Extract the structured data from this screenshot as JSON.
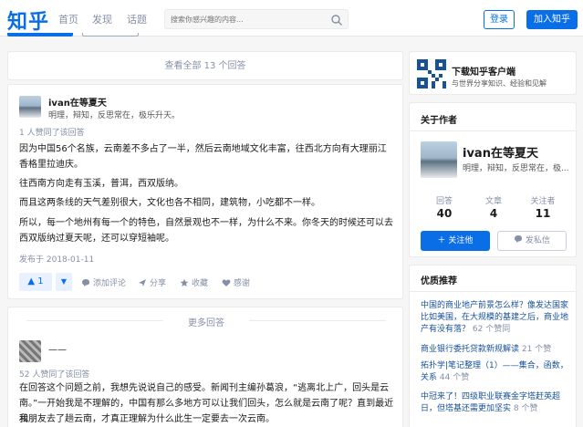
{
  "header": {
    "logo": "知乎",
    "nav": [
      "首页",
      "发现",
      "话题"
    ],
    "search_placeholder": "搜索你感兴趣的内容...",
    "login": "登录",
    "join": "加入知乎"
  },
  "view_all": "查看全部 13 个回答",
  "answer": {
    "author": "ivan在等夏天",
    "bio": "明理，辩知，反思常在，极乐升天。",
    "votes_note": "1 人赞同了该回答",
    "paragraphs": [
      "因为中国56个名族，云南差不多占了一半，然后云南地域文化丰富，往西北方向有大理丽江香格里拉迪庆。",
      "往西南方向走有玉溪，普洱，西双版纳。",
      "而且这两条线的天气差别很大，文化也各不相同，建筑物，小吃都不一样。",
      "所以，每一个地州有每一个的特色，自然景观也不一样，为什么不来。你冬天的时候还可以去西双版纳过夏天呢，还可以穿短袖呢。"
    ],
    "date": "发布于 2018-01-11",
    "vote_count": "1",
    "actions": [
      "添加评论",
      "分享",
      "收藏",
      "感谢"
    ]
  },
  "more": {
    "title": "更多回答",
    "author": "——",
    "votes_note": "52 人赞同了该回答",
    "text_lines": [
      "在回答这个问题之前，我想先说说自己的感受。新闻刊主编孙葛浪，“逃离北上广，回头是云",
      "南。”一开始我是不理解的，中国有那么多地方可以让我们回头，怎么就是云南了呢？直到最近我",
      "和朋友去了趟云南，才真正理解为什么此生一定要去一次云南。"
    ]
  },
  "app": {
    "title": "下载知乎客户端",
    "subtitle": "与世界分享知识、经验和见解"
  },
  "about": {
    "title": "关于作者",
    "name": "ivan在等夏天",
    "bio": "明理，辩知，反思常在，极...",
    "stats": [
      {
        "label": "回答",
        "value": "40"
      },
      {
        "label": "文章",
        "value": "4"
      },
      {
        "label": "关注者",
        "value": "11"
      }
    ],
    "follow": "关注他",
    "message": "发私信"
  },
  "recommend": {
    "title": "优质推荐",
    "items": [
      {
        "lines": [
          "中国的商业地产前景怎么样？像发达国家",
          "比如美国，在大规模的基建之后，商业地",
          "产有没有落？"
        ],
        "count": "62 个赞同"
      },
      {
        "lines": [
          "商业银行委托贷款新规解读"
        ],
        "count": "21 个赞"
      },
      {
        "lines": [
          "拓扑学|笔记整理（1）——集合，函数，",
          "关系"
        ],
        "count": "44 个赞"
      },
      {
        "lines": [
          "中冠来了！四级职业联赛金字塔赶英超",
          "日，但塔基还需更加坚实"
        ],
        "count": "8 个赞"
      }
    ]
  },
  "colors": {
    "brand": "#0a6fe6",
    "muted": "#8590a6",
    "link": "#175199"
  }
}
